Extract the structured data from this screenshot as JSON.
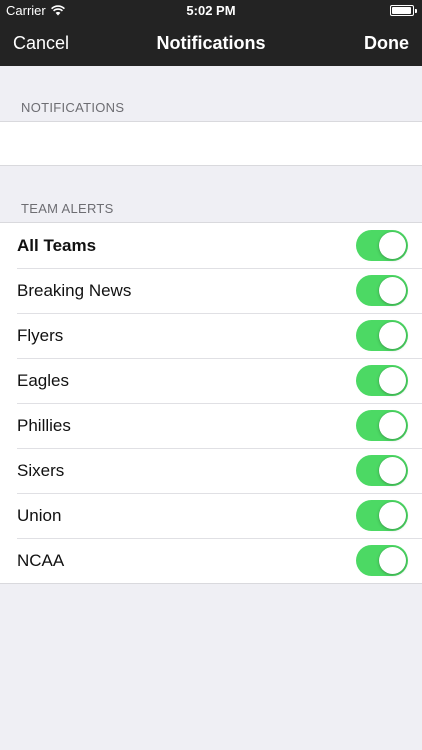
{
  "status_bar": {
    "carrier": "Carrier",
    "time": "5:02 PM",
    "battery_level": 0.95
  },
  "nav_bar": {
    "left_button": "Cancel",
    "title": "Notifications",
    "right_button": "Done"
  },
  "sections": {
    "notifications_header": "NOTIFICATIONS",
    "team_alerts_header": "TEAM ALERTS"
  },
  "team_alerts": [
    {
      "label": "All Teams",
      "on": true
    },
    {
      "label": "Breaking News",
      "on": true
    },
    {
      "label": "Flyers",
      "on": true
    },
    {
      "label": "Eagles",
      "on": true
    },
    {
      "label": "Phillies",
      "on": true
    },
    {
      "label": "Sixers",
      "on": true
    },
    {
      "label": "Union",
      "on": true
    },
    {
      "label": "NCAA",
      "on": true
    }
  ],
  "colors": {
    "header_bg": "#232323",
    "toggle_on": "#4cd964",
    "background": "#efeff4"
  },
  "icons": {
    "wifi": "wifi-icon",
    "battery": "battery-icon"
  }
}
